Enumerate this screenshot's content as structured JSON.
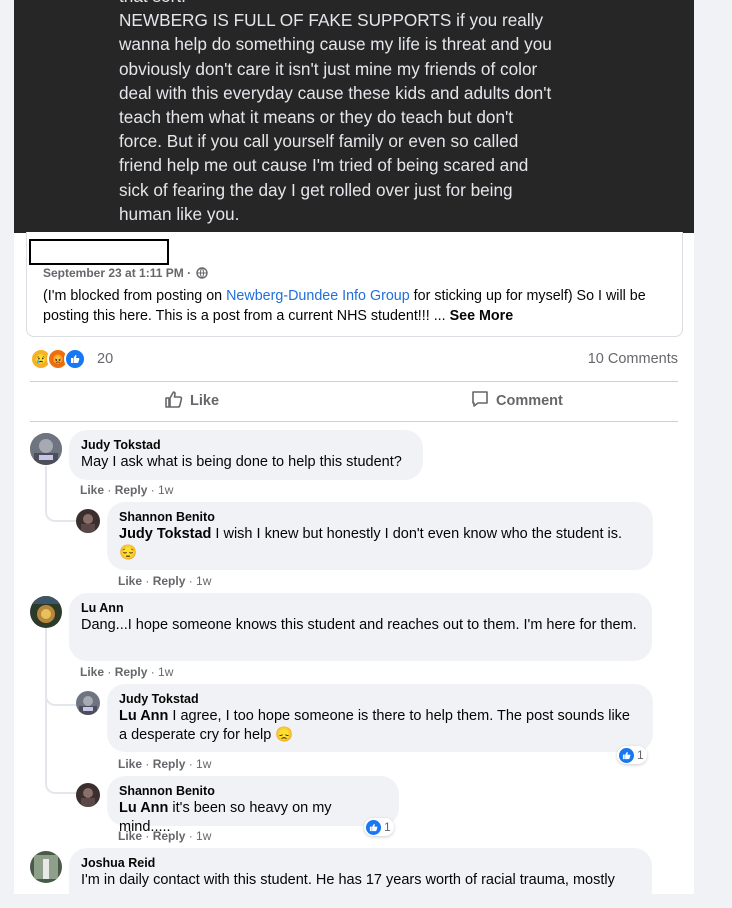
{
  "image_text": "that sort.\nNEWBERG IS FULL OF FAKE SUPPORTS if you really\nwanna help do something cause my life is threat and you\nobviously don't care it isn't just mine my friends of color\ndeal with this everyday cause these kids and adults don't\nteach them what it means or they do teach but don't\nforce. But if you call yourself family or even so called\nfriend help me out cause I'm tried of being scared and\nsick of fearing the day I get rolled over just for being\nhuman like you.",
  "post": {
    "timestamp": "September 23 at 1:11 PM ·",
    "text_before": "(I'm blocked from posting on ",
    "group_link": "Newberg-Dundee Info Group",
    "text_after": " for sticking up for myself) So I will be posting this here. This is a post from a current NHS student!!! ... ",
    "see_more": "See More"
  },
  "reactions": {
    "count": "20",
    "comments": "10 Comments"
  },
  "actions": {
    "like": "Like",
    "comment": "Comment"
  },
  "comments": [
    {
      "name": "Judy Tokstad",
      "text": "May I ask what is being done to help this student?",
      "like": "Like",
      "reply": "Reply",
      "time": "1w"
    },
    {
      "name": "Shannon Benito",
      "mention": "Judy Tokstad",
      "text": " I wish I knew but honestly I don't even know who the student is.",
      "emoji": "😔",
      "like": "Like",
      "reply": "Reply",
      "time": "1w"
    },
    {
      "name": "Lu Ann",
      "text": "Dang...I hope someone knows this student and reaches out to them. I'm here for them.",
      "like": "Like",
      "reply": "Reply",
      "time": "1w"
    },
    {
      "name": "Judy Tokstad",
      "mention": "Lu Ann",
      "text": " I agree, I too hope someone is there to help them. The post sounds like a desperate cry for help ",
      "emoji": "😞",
      "like": "Like",
      "reply": "Reply",
      "time": "1w",
      "likes": "1"
    },
    {
      "name": "Shannon Benito",
      "mention": "Lu Ann",
      "text": " it's been so heavy on my mind.....",
      "like": "Like",
      "reply": "Reply",
      "time": "1w",
      "likes": "1"
    },
    {
      "name": "Joshua Reid",
      "text": "I'm in daily contact with this student. He has 17 years worth of racial trauma, mostly"
    }
  ],
  "colors": {
    "link": "#216fdb",
    "like_blue": "#1877f2",
    "muted": "#65676b"
  }
}
